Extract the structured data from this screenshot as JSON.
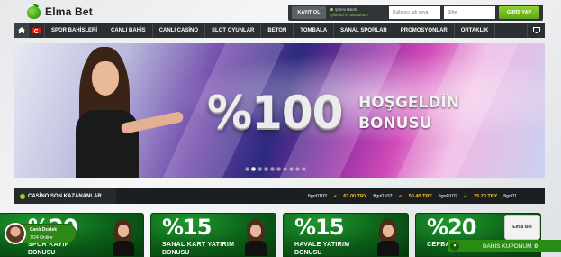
{
  "brand": {
    "name": "Elma Bet"
  },
  "login": {
    "register_label": "KAYIT OL",
    "forgot_line1": "Şifreni Hatırla",
    "forgot_line2": "Şifrenizi mi unuttunuz?",
    "username_placeholder": "Kullanıcı adı veya",
    "password_placeholder": "Şifre",
    "login_label": "GİRİŞ YAP"
  },
  "nav": {
    "items": [
      {
        "label": "SPOR BAHİSLERİ"
      },
      {
        "label": "CANLI BAHİS"
      },
      {
        "label": "CANLI CASİNO"
      },
      {
        "label": "SLOT OYUNLAR"
      },
      {
        "label": "BETON"
      },
      {
        "label": "TOMBALA"
      },
      {
        "label": "SANAL SPORLAR"
      },
      {
        "label": "PROMOSYONLAR"
      },
      {
        "label": "ORTAKLIK"
      }
    ],
    "icons": {
      "home": "home-icon",
      "flag": "turkey-flag-icon",
      "tv": "tv-icon"
    }
  },
  "banner": {
    "headline": "%100",
    "line1": "HOŞGELDİN",
    "line2": "BONUSU",
    "slide_count": 10,
    "active_slide": 2
  },
  "winners": {
    "title": "CASİNO SON KAZANANLAR",
    "entries": [
      {
        "user": "figo0102",
        "amount": "63.00 TRY"
      },
      {
        "user": "figo0102",
        "amount": "50.40 TRY"
      },
      {
        "user": "figo0102",
        "amount": "25.20 TRY"
      },
      {
        "user": "figo01",
        "amount": ""
      }
    ]
  },
  "promos": [
    {
      "big": "%20",
      "line1": "SPOR KAYIP",
      "line2": "BONUSU"
    },
    {
      "big": "%15",
      "line1": "SANAL KART YATIRIM",
      "line2": "BONUSU"
    },
    {
      "big": "%15",
      "line1": "HAVALE YATIRIM",
      "line2": "BONUSU"
    },
    {
      "big": "%20",
      "line1": "CEPBANK",
      "line2": ""
    }
  ],
  "support": {
    "title": "Canlı Destek",
    "subtitle": "7/24 Online"
  },
  "betslip": {
    "label": "BAHİS KUPONUM",
    "count": "0"
  },
  "mini_logo": "Elma Bet",
  "colors": {
    "accent": "#8fd32f",
    "dark_bar": "#2b2f31",
    "promo_green": "#0b5c17",
    "winner_amount": "#f1c232"
  }
}
